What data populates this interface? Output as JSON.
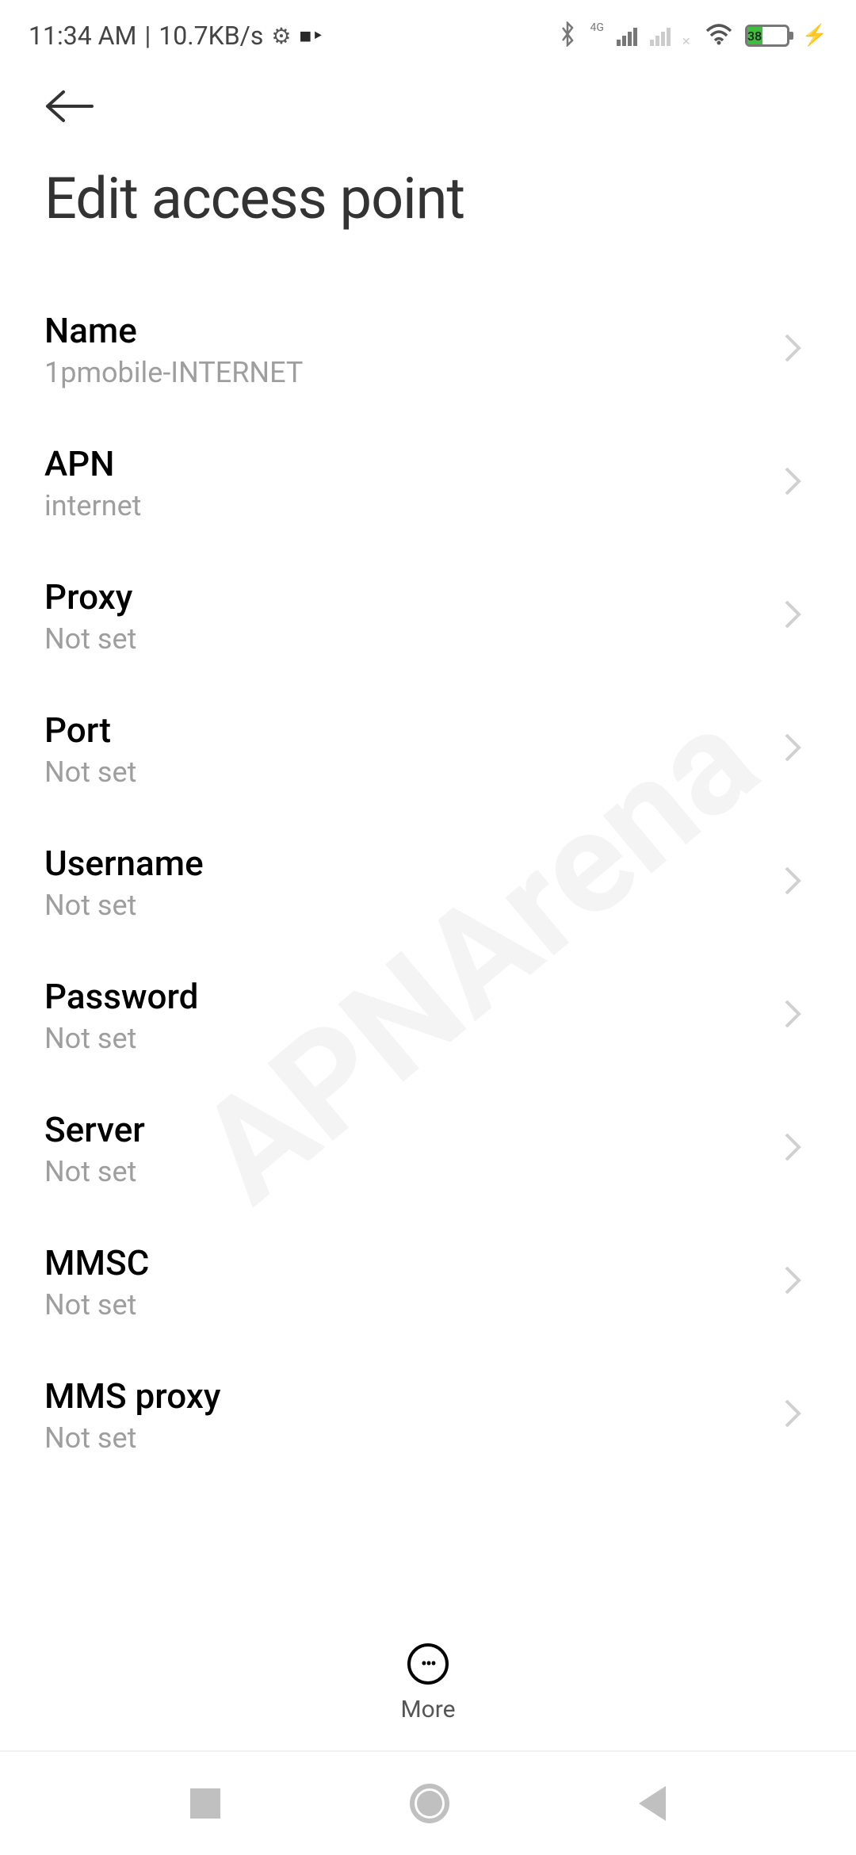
{
  "status": {
    "time": "11:34 AM",
    "data_rate": "10.7KB/s",
    "network_label": "4G",
    "battery_pct": "38"
  },
  "page": {
    "title": "Edit access point"
  },
  "settings": [
    {
      "label": "Name",
      "value": "1pmobile-INTERNET"
    },
    {
      "label": "APN",
      "value": "internet"
    },
    {
      "label": "Proxy",
      "value": "Not set"
    },
    {
      "label": "Port",
      "value": "Not set"
    },
    {
      "label": "Username",
      "value": "Not set"
    },
    {
      "label": "Password",
      "value": "Not set"
    },
    {
      "label": "Server",
      "value": "Not set"
    },
    {
      "label": "MMSC",
      "value": "Not set"
    },
    {
      "label": "MMS proxy",
      "value": "Not set"
    }
  ],
  "bottom": {
    "more_label": "More"
  },
  "watermark": "APNArena"
}
